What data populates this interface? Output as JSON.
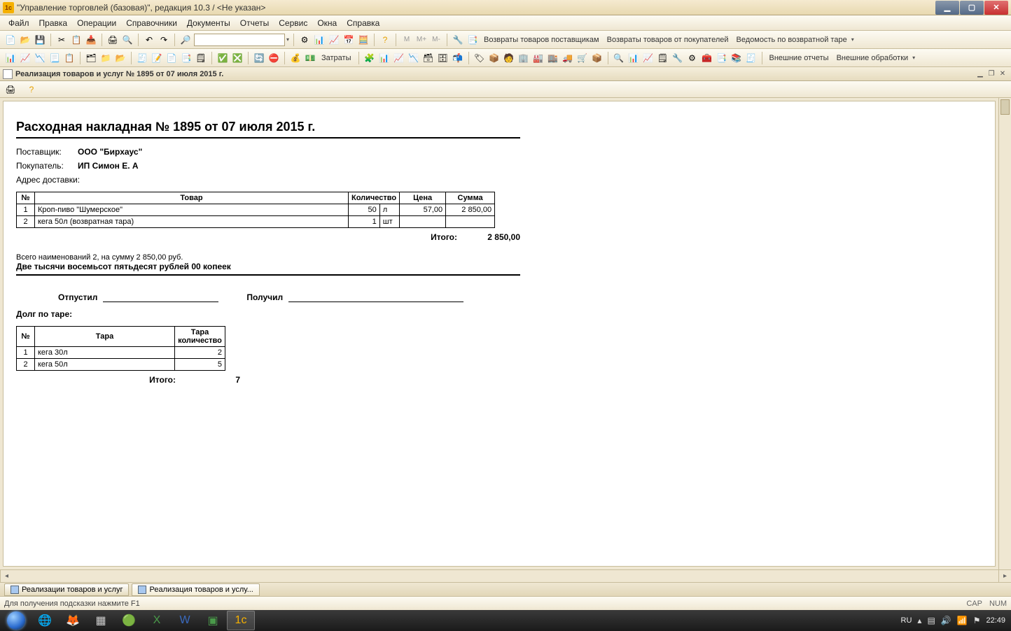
{
  "window": {
    "title": "\"Управление торговлей (базовая)\", редакция 10.3 / <Не указан>"
  },
  "menu": [
    "Файл",
    "Правка",
    "Операции",
    "Справочники",
    "Документы",
    "Отчеты",
    "Сервис",
    "Окна",
    "Справка"
  ],
  "toolbar1_text_buttons": {
    "returns_suppliers": "Возвраты товаров поставщикам",
    "returns_customers": "Возвраты товаров от покупателей",
    "tare_statement": "Ведомость по возвратной таре"
  },
  "toolbar2_text_buttons": {
    "expenses": "Затраты",
    "external_reports": "Внешние отчеты",
    "external_processing": "Внешние обработки"
  },
  "doc_tab": {
    "title": "Реализация товаров и услуг № 1895 от 07 июля 2015 г."
  },
  "document": {
    "title": "Расходная накладная № 1895 от 07 июля 2015 г.",
    "supplier_label": "Поставщик:",
    "supplier": "ООО \"Бирхаус\"",
    "buyer_label": "Покупатель:",
    "buyer": "ИП Симон Е. А",
    "delivery_address_label": "Адрес доставки:",
    "goods": {
      "headers": {
        "num": "№",
        "name": "Товар",
        "qty": "Количество",
        "price": "Цена",
        "sum": "Сумма"
      },
      "rows": [
        {
          "num": "1",
          "name": "Кроп-пиво \"Шумерское\"",
          "qty": "50",
          "unit": "л",
          "price": "57,00",
          "sum": "2 850,00"
        },
        {
          "num": "2",
          "name": "кега 50л (возвратная тара)",
          "qty": "1",
          "unit": "шт",
          "price": "",
          "sum": ""
        }
      ],
      "total_label": "Итого:",
      "total": "2 850,00"
    },
    "summary_line": "Всего наименований 2, на сумму 2 850,00 руб.",
    "summary_words": "Две тысячи восемьсот пятьдесят рублей 00 копеек",
    "released_label": "Отпустил",
    "received_label": "Получил",
    "tare_debt_label": "Долг по таре:",
    "tare": {
      "headers": {
        "num": "№",
        "name": "Тара",
        "qty": "Тара количество"
      },
      "rows": [
        {
          "num": "1",
          "name": "кега 30л",
          "qty": "2"
        },
        {
          "num": "2",
          "name": "кега 50л",
          "qty": "5"
        }
      ],
      "total_label": "Итого:",
      "total": "7"
    }
  },
  "bottom_tabs": {
    "tab1": "Реализации товаров и услуг",
    "tab2": "Реализация товаров и услу..."
  },
  "statusbar": {
    "hint": "Для получения подсказки нажмите F1",
    "cap": "CAP",
    "num": "NUM"
  },
  "tray": {
    "lang": "RU",
    "time": "22:49"
  }
}
